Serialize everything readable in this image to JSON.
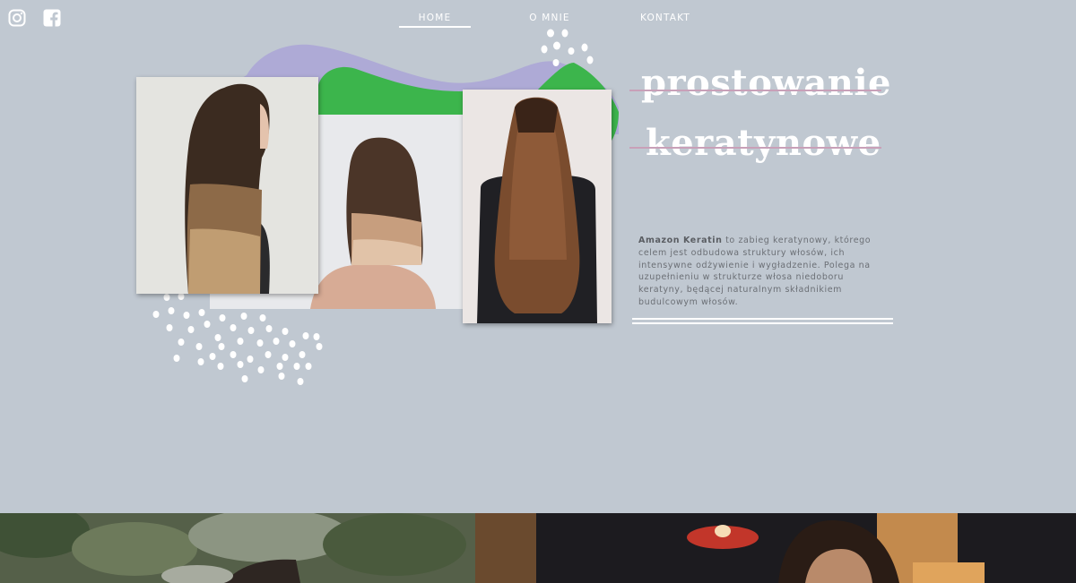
{
  "social": {
    "icons": [
      "instagram-icon",
      "facebook-icon"
    ]
  },
  "nav": {
    "home": "HOME",
    "about": "O MNIE",
    "contact": "KONTAKT"
  },
  "hero": {
    "title_line1": "prostowanie",
    "title_line2": "keratynowe",
    "description_bold": "Amazon Keratin",
    "description_rest": " to zabieg keratynowy, którego celem jest odbudowa struktury włosów, ich intensywne odżywienie i wygładzenie. Polega na uzupełnieniu w strukturze włosa niedoboru keratyny, będącej naturalnym składnikiem budulcowym włosów."
  },
  "colors": {
    "background": "#c0c8d1",
    "blob_purple": "#aeaad6",
    "blob_green": "#3cb54c",
    "strike": "#c8a0b8",
    "text": "#6b6f75"
  }
}
